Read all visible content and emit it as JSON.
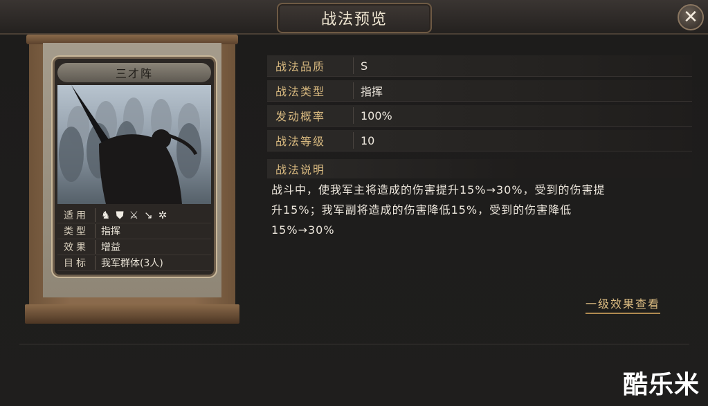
{
  "window": {
    "title": "战法预览",
    "close_icon": "close-icon"
  },
  "card": {
    "name": "三才阵",
    "rows": [
      {
        "label": "适用",
        "icons": [
          "cavalry-icon",
          "shield-icon",
          "bow-icon",
          "spear-icon",
          "wheel-icon"
        ]
      },
      {
        "label": "类型",
        "value": "指挥"
      },
      {
        "label": "效果",
        "value": "增益"
      },
      {
        "label": "目标",
        "value": "我军群体(3人)"
      }
    ]
  },
  "info": {
    "rows": [
      {
        "label": "战法品质",
        "value": "S"
      },
      {
        "label": "战法类型",
        "value": "指挥"
      },
      {
        "label": "发动概率",
        "value": "100%"
      },
      {
        "label": "战法等级",
        "value": "10"
      }
    ],
    "desc_label": "战法说明",
    "desc_lines": [
      "战斗中，使我军主将造成的伤害提升15%→30%，受到的伤害提",
      "升15%；我军副将造成的伤害降低15%，受到的伤害降低",
      "15%→30%"
    ],
    "level_link": "一级效果查看"
  },
  "watermark": "酷乐米"
}
